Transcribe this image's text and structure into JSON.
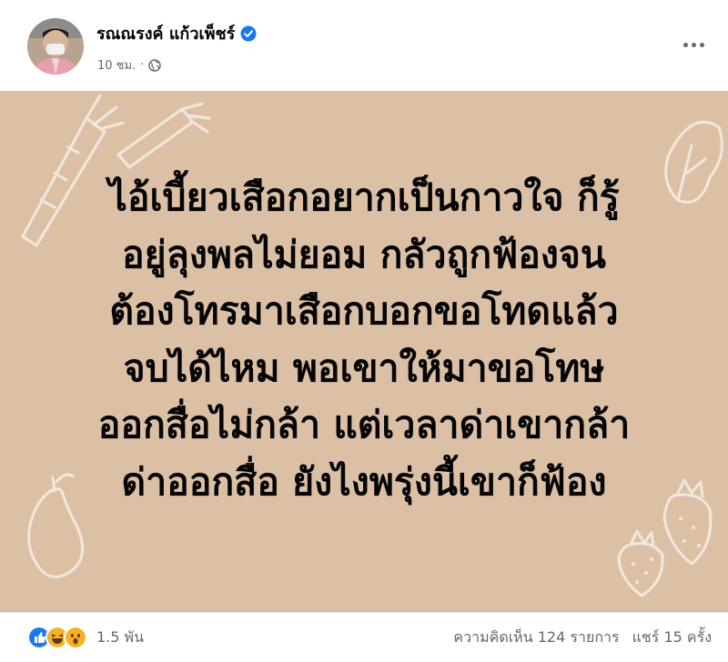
{
  "post": {
    "author": "รณณรงค์ แก้วเพ็ชร์",
    "time": "10 ชม.",
    "separator": "·",
    "lines": [
      "ไอ้เบี้ยวเสือกอยากเป็นกาวใจ ก็รู้",
      "อยู่ลุงพลไม่ยอม กลัวถูกฟ้องจน",
      "ต้องโทรมาเสือกบอกขอโทดแล้ว",
      "จบได้ไหม พอเขาให้มาขอโทษ",
      "ออกสื่อไม่กล้า แต่เวลาด่าเขากล้า",
      "ด่าออกสื่อ ยังไงพรุ่งนี้เขาก็ฟ้อง"
    ],
    "background_color": "#dcc0a6"
  },
  "footer": {
    "reactions_count": "1.5 พัน",
    "comments": "ความคิดเห็น 124 รายการ",
    "shares": "แชร์ 15 ครั้ง"
  },
  "icons": {
    "verified": "verified-badge-icon",
    "privacy": "globe-icon",
    "more": "more-options-icon",
    "reactions": [
      "like-icon",
      "haha-icon",
      "wow-icon"
    ]
  },
  "colors": {
    "accent": "#1877f2",
    "secondary_text": "#65676b"
  }
}
